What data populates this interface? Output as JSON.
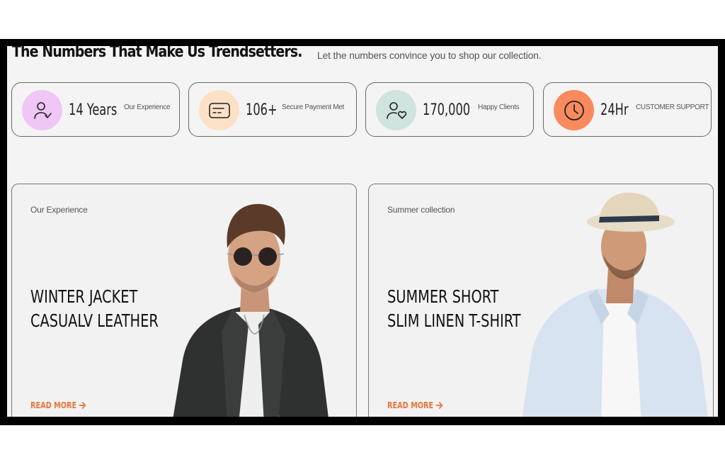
{
  "header": {
    "title": "The Numbers That Make Us Trendsetters.",
    "subtitle": "Let the numbers convince you to shop our collection."
  },
  "stats": [
    {
      "value": "14 Years",
      "label": "Our Experience",
      "icon": "user-check-icon",
      "color": "#f0c6f6"
    },
    {
      "value": "106+",
      "label": "Secure Payment Met",
      "icon": "credit-card-icon",
      "color": "#fde1c6"
    },
    {
      "value": "170,000",
      "label": "Happy Clients",
      "icon": "user-heart-icon",
      "color": "#cfe3df"
    },
    {
      "value": "24Hr",
      "label": "CUSTOMER SUPPORT",
      "icon": "clock-icon",
      "color": "#f98a5d"
    }
  ],
  "cards": [
    {
      "tag": "Our Experience",
      "title_line1": "WINTER JACKET",
      "title_line2": "CASUALV LEATHER",
      "cta": "READ MORE"
    },
    {
      "tag": "Summer collection",
      "title_line1": "SUMMER SHORT",
      "title_line2": "SLIM LINEN T-SHIRT",
      "cta": "READ MORE"
    }
  ],
  "colors": {
    "accent": "#e8743b",
    "page_bg": "#f4f4f4",
    "frame": "#000000"
  }
}
